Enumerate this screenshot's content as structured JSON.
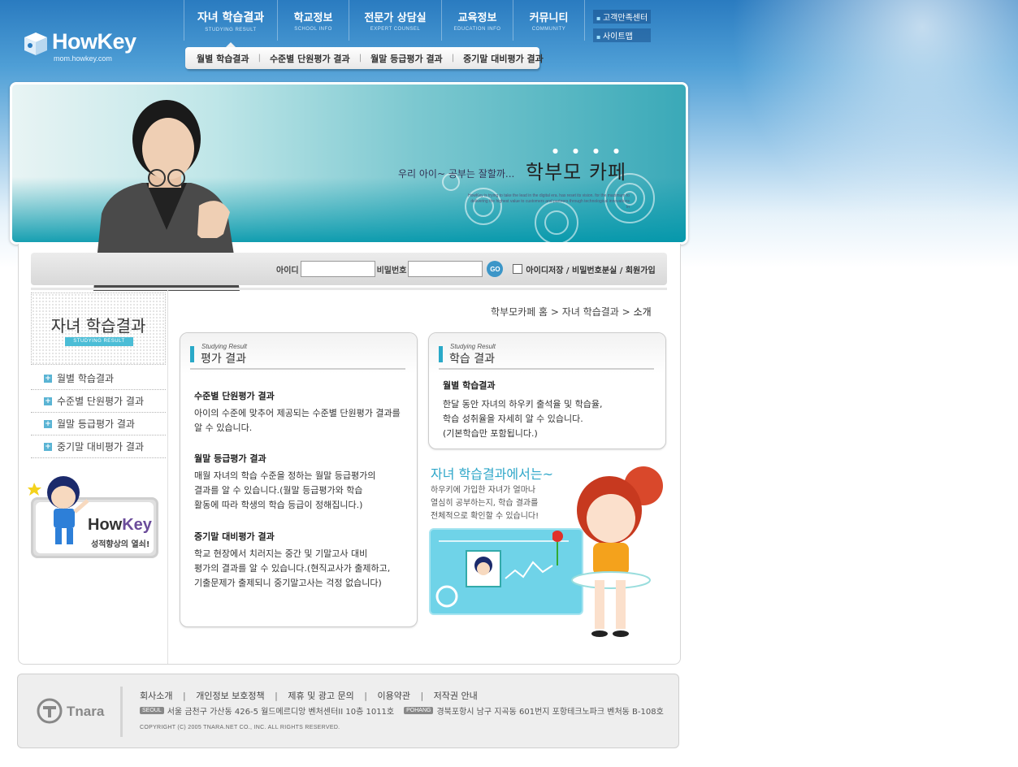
{
  "logo": {
    "brand": "HowKey",
    "url": "mom.howkey.com"
  },
  "nav": {
    "items": [
      {
        "ko": "자녀 학습결과",
        "en": "STUDYING RESULT",
        "active": true
      },
      {
        "ko": "학교정보",
        "en": "SCHOOL INFO"
      },
      {
        "ko": "전문가 상담실",
        "en": "EXPERT COUNSEL"
      },
      {
        "ko": "교육정보",
        "en": "EDUCATION INFO"
      },
      {
        "ko": "커뮤니티",
        "en": "COMMUNITY"
      }
    ],
    "util": [
      "고객만족센터",
      "사이트맵"
    ]
  },
  "submenu": [
    "월별 학습결과",
    "수준별 단원평가 결과",
    "월말 등급평가 결과",
    "중기말 대비평가 결과"
  ],
  "banner": {
    "tagline": "우리 아이~ 공부는 잘할까...",
    "title": "학부모 카페",
    "small_text": "HowKey is trying to take the lead in the digital era. has reset its vision. for the maximum to delivering the highest value to customers and partners through technological innovations in"
  },
  "login": {
    "id_label": "아이디",
    "pw_label": "비밀번호",
    "go_label": "GO",
    "links": "아이디저장 / 비밀번호분실 / 회원가입"
  },
  "sidebar": {
    "title": "자녀 학습결과",
    "subtitle": "STUDYING RESULT",
    "items": [
      "월별 학습결과",
      "수준별 단원평가 결과",
      "월말 등급평가 결과",
      "중기말 대비평가 결과"
    ],
    "banner_brand_1": "How",
    "banner_brand_2": "Key",
    "banner_tag": "성적향상의 열쇠!"
  },
  "breadcrumb": {
    "home": "학부모카페 홈",
    "sep": ">",
    "section": "자녀 학습결과",
    "current": "소개"
  },
  "eval_card": {
    "en": "Studying Result",
    "title": "평가 결과",
    "sections": [
      {
        "head": "수준별 단원평가 결과",
        "body": [
          "아이의 수준에 맞추어 제공되는 수준별 단원평가 결과를",
          "알 수 있습니다."
        ]
      },
      {
        "head": "월말 등급평가 결과",
        "body": [
          "매월 자녀의 학습 수준을 정하는 월말 등급평가의",
          "결과를 알 수 있습니다.(월말 등급평가와 학습",
          "활동에 따라 학생의 학습 등급이 정해집니다.)"
        ]
      },
      {
        "head": "중기말 대비평가 결과",
        "body": [
          "학교 현장에서 치러지는 중간 및 기말고사 대비",
          "평가의 결과를 알 수 있습니다.(현직교사가 출제하고,",
          "기출문제가 출제되니 중기말고사는 걱정 없습니다)"
        ]
      }
    ]
  },
  "study_card": {
    "en": "Studying Result",
    "title": "학습 결과",
    "head": "월별 학습결과",
    "body": [
      "한달 동안 자녀의 하우키 출석율 및 학습율,",
      "학습 성취율을 자세히 알 수 있습니다.",
      "(기본학습만 포함됩니다.)"
    ]
  },
  "promo": {
    "title": "자녀 학습결과에서는~",
    "lines": [
      "하우키에 가입한 자녀가 얼마나",
      "열심히 공부하는지, 학습 결과를",
      "전체적으로 확인할 수 있습니다!"
    ]
  },
  "footer": {
    "logo": "Tnara",
    "links": [
      "회사소개",
      "개인정보 보호정책",
      "제휴 및 광고 문의",
      "이용약관",
      "저작권 안내"
    ],
    "seoul_tag": "SEOUL",
    "seoul_addr": "서울 금천구 가산동 426-5 월드메르디앙 벤처센터II 10층 1011호",
    "pohang_tag": "POHANG",
    "pohang_addr": "경북포항시 남구 지곡동 601번지 포항테크노파크 벤처동 B-108호",
    "copyright": "COPYRIGHT (C) 2005 TNARA.NET CO., INC. ALL RIGHTS RESERVED."
  },
  "colors": {
    "accent": "#2fa7c9",
    "sky": "#2a7bc0",
    "bar": "#2aa9c8"
  }
}
